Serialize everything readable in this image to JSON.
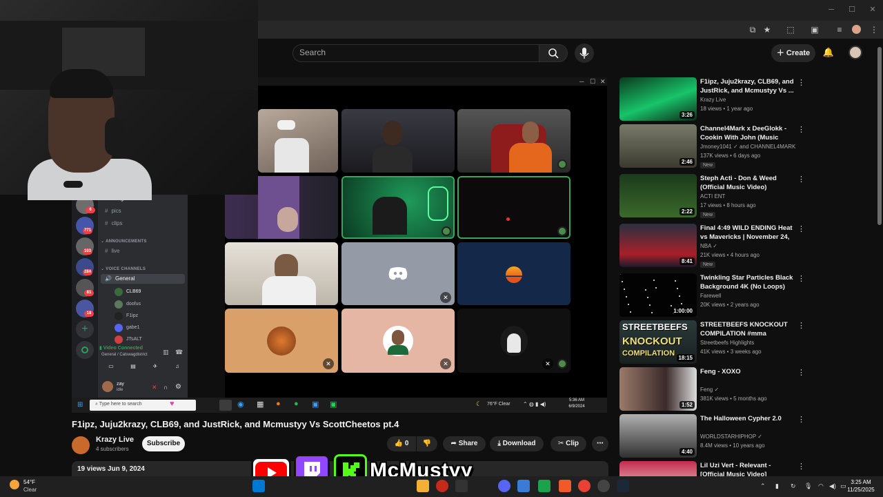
{
  "youtube": {
    "search_placeholder": "Search",
    "create_label": "Create"
  },
  "video": {
    "title": "F1ipz, Juju2krazy, CLB69, and JustRick, and Mcmustyy Vs ScottCheetos pt.4",
    "channel": "Krazy Live",
    "subscribers": "4 subscribers",
    "subscribe_label": "Subscribe",
    "like_count": "0",
    "share_label": "Share",
    "download_label": "Download",
    "clip_label": "Clip",
    "meta": "19 views  Jun 9, 2024"
  },
  "discord": {
    "channels": [
      {
        "name": "hang-out"
      },
      {
        "name": "pics"
      },
      {
        "name": "clips"
      }
    ],
    "announcements_header": "ANNOUNCEMENTS",
    "announcement_channel": "live",
    "voice_header": "VOICE CHANNELS",
    "voice_channel": "General",
    "voice_users": [
      "CLB69",
      "doofus",
      "F1ipz",
      "gabe1",
      "JTsALT"
    ],
    "connection_status": "Video Connected",
    "connection_detail": "General / Calswagdistrict",
    "user_name": "zay",
    "user_status": "idle",
    "server_badges": [
      "6",
      "771",
      "103",
      "284",
      "81",
      "18"
    ]
  },
  "inner_taskbar": {
    "search_placeholder": "Type here to search",
    "weather": "76°F  Clear",
    "time": "5:36 AM",
    "date": "6/9/2024"
  },
  "suggestions": [
    {
      "title": "F1ipz, Juju2krazy, CLB69, and JustRick, and Mcmustyy Vs ...",
      "channel": "Krazy Live",
      "meta": "18 views • 1 year ago",
      "duration": "3:26",
      "new": ""
    },
    {
      "title": "Channel4Mark x DeeGlokk - Cookin With John (Music Vide...",
      "channel": "Jmoney1041 ✓ and CHANNEL4MARK",
      "meta": "137K views • 6 days ago",
      "duration": "2:46",
      "new": "New"
    },
    {
      "title": "Steph Acti - Don & Weed (Official Music Video)",
      "channel": "ACTI ENT",
      "meta": "17 views • 8 hours ago",
      "duration": "2:22",
      "new": "New"
    },
    {
      "title": "Final 4:49 WILD ENDING Heat vs Mavericks | November 24, ...",
      "channel": "NBA ✓",
      "meta": "21K views • 4 hours ago",
      "duration": "8:41",
      "new": "New"
    },
    {
      "title": "Twinkling Star Particles Black Background 4K (No Loops)",
      "channel": "Farewell",
      "meta": "20K views • 2 years ago",
      "duration": "1:00:00",
      "new": ""
    },
    {
      "title": "STREETBEEFS KNOCKOUT COMPILATION #mma #boxing...",
      "channel": "Streetbeefs Highlights",
      "meta": "41K views • 3 weeks ago",
      "duration": "18:15",
      "new": ""
    },
    {
      "title": "Feng - XOXO",
      "channel": "Feng ✓",
      "meta": "381K views • 5 months ago",
      "duration": "1:52",
      "new": ""
    },
    {
      "title": "The Halloween Cypher 2.0",
      "channel": "WORLDSTARHIPHOP ✓",
      "meta": "8.4M views • 10 years ago",
      "duration": "4:40",
      "new": ""
    },
    {
      "title": "Lil Uzi Vert - Relevant - [Official Music Video]",
      "channel": "",
      "meta": "",
      "duration": "",
      "new": ""
    }
  ],
  "thumb_texts": {
    "streetbeefs_top": "STREETBEEFS",
    "streetbeefs_mid": "KNOCKOUT",
    "streetbeefs_bot": "COMPILATION"
  },
  "taskbar": {
    "weather_temp": "54°F",
    "weather_desc": "Clear",
    "time": "3:25 AM",
    "date": "11/25/2025"
  },
  "overlay": {
    "brand": "McMustyy"
  },
  "colors": {
    "youtube_red": "#ff0000",
    "twitch_purple": "#9146ff",
    "kick_green": "#53fc18",
    "discord_blurple": "#5865f2",
    "discord_green": "#3ba55d"
  }
}
